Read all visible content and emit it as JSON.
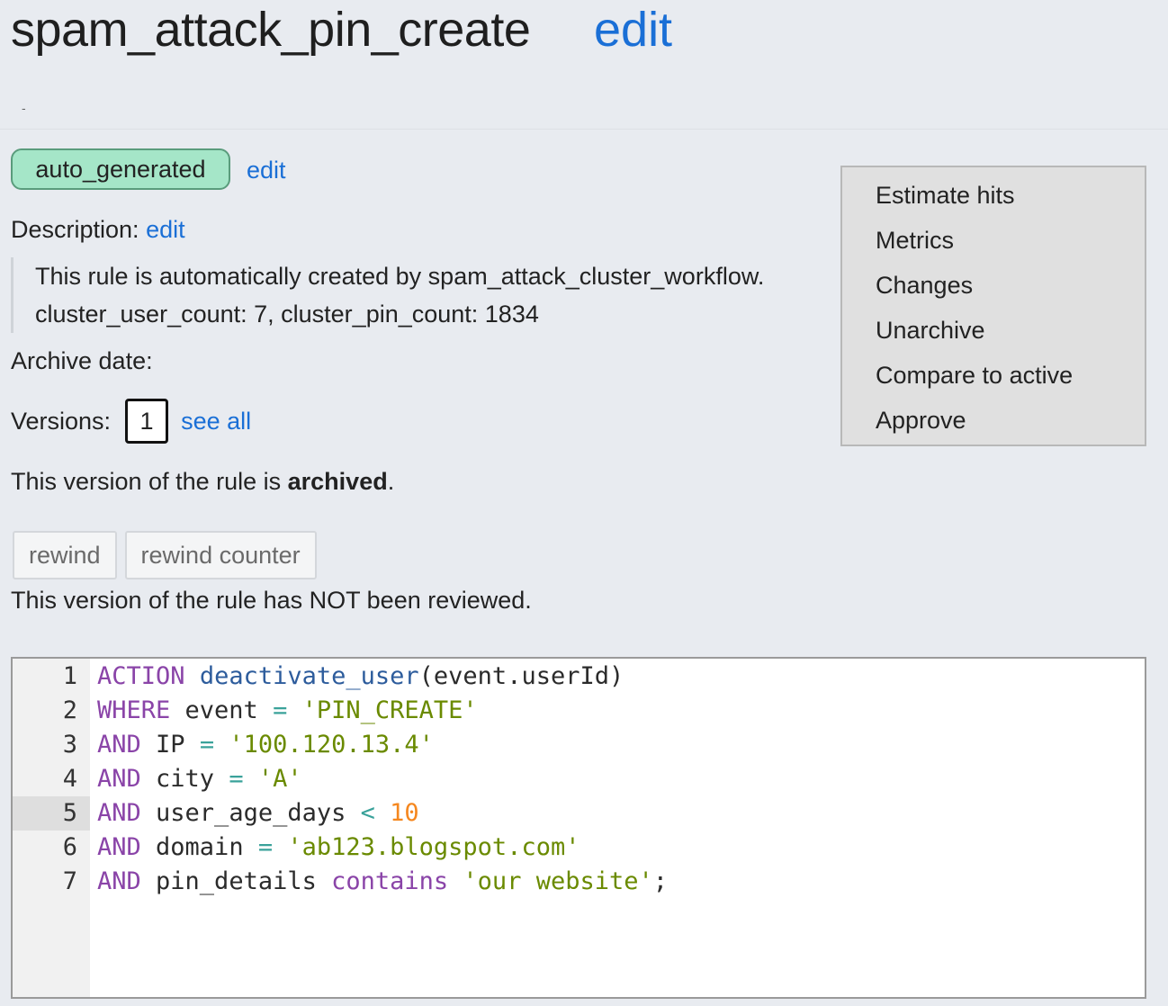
{
  "header": {
    "title": "spam_attack_pin_create",
    "edit_label": "edit",
    "dash": "-"
  },
  "tag": {
    "label": "auto_generated",
    "edit_label": "edit"
  },
  "description": {
    "label": "Description:",
    "edit_label": "edit",
    "lines": [
      "This rule is automatically created by spam_attack_cluster_workflow.",
      "cluster_user_count: 7, cluster_pin_count: 1834"
    ]
  },
  "archive": {
    "label": "Archive date:"
  },
  "versions": {
    "label": "Versions:",
    "current": "1",
    "see_all_label": "see all"
  },
  "status": {
    "prefix": "This version of the rule is ",
    "state": "archived",
    "suffix": "."
  },
  "buttons": {
    "rewind": "rewind",
    "rewind_counter": "rewind counter"
  },
  "review": {
    "text": "This version of the rule has NOT been reviewed."
  },
  "menu": {
    "items": [
      "Estimate hits",
      "Metrics",
      "Changes",
      "Unarchive",
      "Compare to active",
      "Approve"
    ]
  },
  "editor": {
    "active_line": 5,
    "line_numbers": [
      "1",
      "2",
      "3",
      "4",
      "5",
      "6",
      "7"
    ],
    "lines": [
      [
        [
          "kw",
          "ACTION"
        ],
        [
          "txt",
          " "
        ],
        [
          "fn",
          "deactivate_user"
        ],
        [
          "txt",
          "(event.userId)"
        ]
      ],
      [
        [
          "kw",
          "WHERE"
        ],
        [
          "txt",
          " event "
        ],
        [
          "op",
          "="
        ],
        [
          "txt",
          " "
        ],
        [
          "str",
          "'PIN_CREATE'"
        ]
      ],
      [
        [
          "kw",
          "AND"
        ],
        [
          "txt",
          " IP "
        ],
        [
          "op",
          "="
        ],
        [
          "txt",
          " "
        ],
        [
          "str",
          "'100.120.13.4'"
        ]
      ],
      [
        [
          "kw",
          "AND"
        ],
        [
          "txt",
          " city "
        ],
        [
          "op",
          "="
        ],
        [
          "txt",
          " "
        ],
        [
          "str",
          "'A'"
        ]
      ],
      [
        [
          "kw",
          "AND"
        ],
        [
          "txt",
          " user_age_days "
        ],
        [
          "op",
          "<"
        ],
        [
          "txt",
          " "
        ],
        [
          "num",
          "10"
        ]
      ],
      [
        [
          "kw",
          "AND"
        ],
        [
          "txt",
          " domain "
        ],
        [
          "op",
          "="
        ],
        [
          "txt",
          " "
        ],
        [
          "str",
          "'ab123.blogspot.com'"
        ]
      ],
      [
        [
          "kw",
          "AND"
        ],
        [
          "txt",
          " pin_details "
        ],
        [
          "kw",
          "contains"
        ],
        [
          "txt",
          " "
        ],
        [
          "str",
          "'our website'"
        ],
        [
          "txt",
          ";"
        ]
      ]
    ]
  },
  "colors": {
    "link": "#1a6fd6",
    "tag_bg": "#a5e6c8",
    "page_bg": "#e8ebf0",
    "keyword": "#8a44a8",
    "function": "#2d5c9c",
    "string": "#6a8a00",
    "operator": "#3aa29a",
    "number": "#f5871f"
  }
}
